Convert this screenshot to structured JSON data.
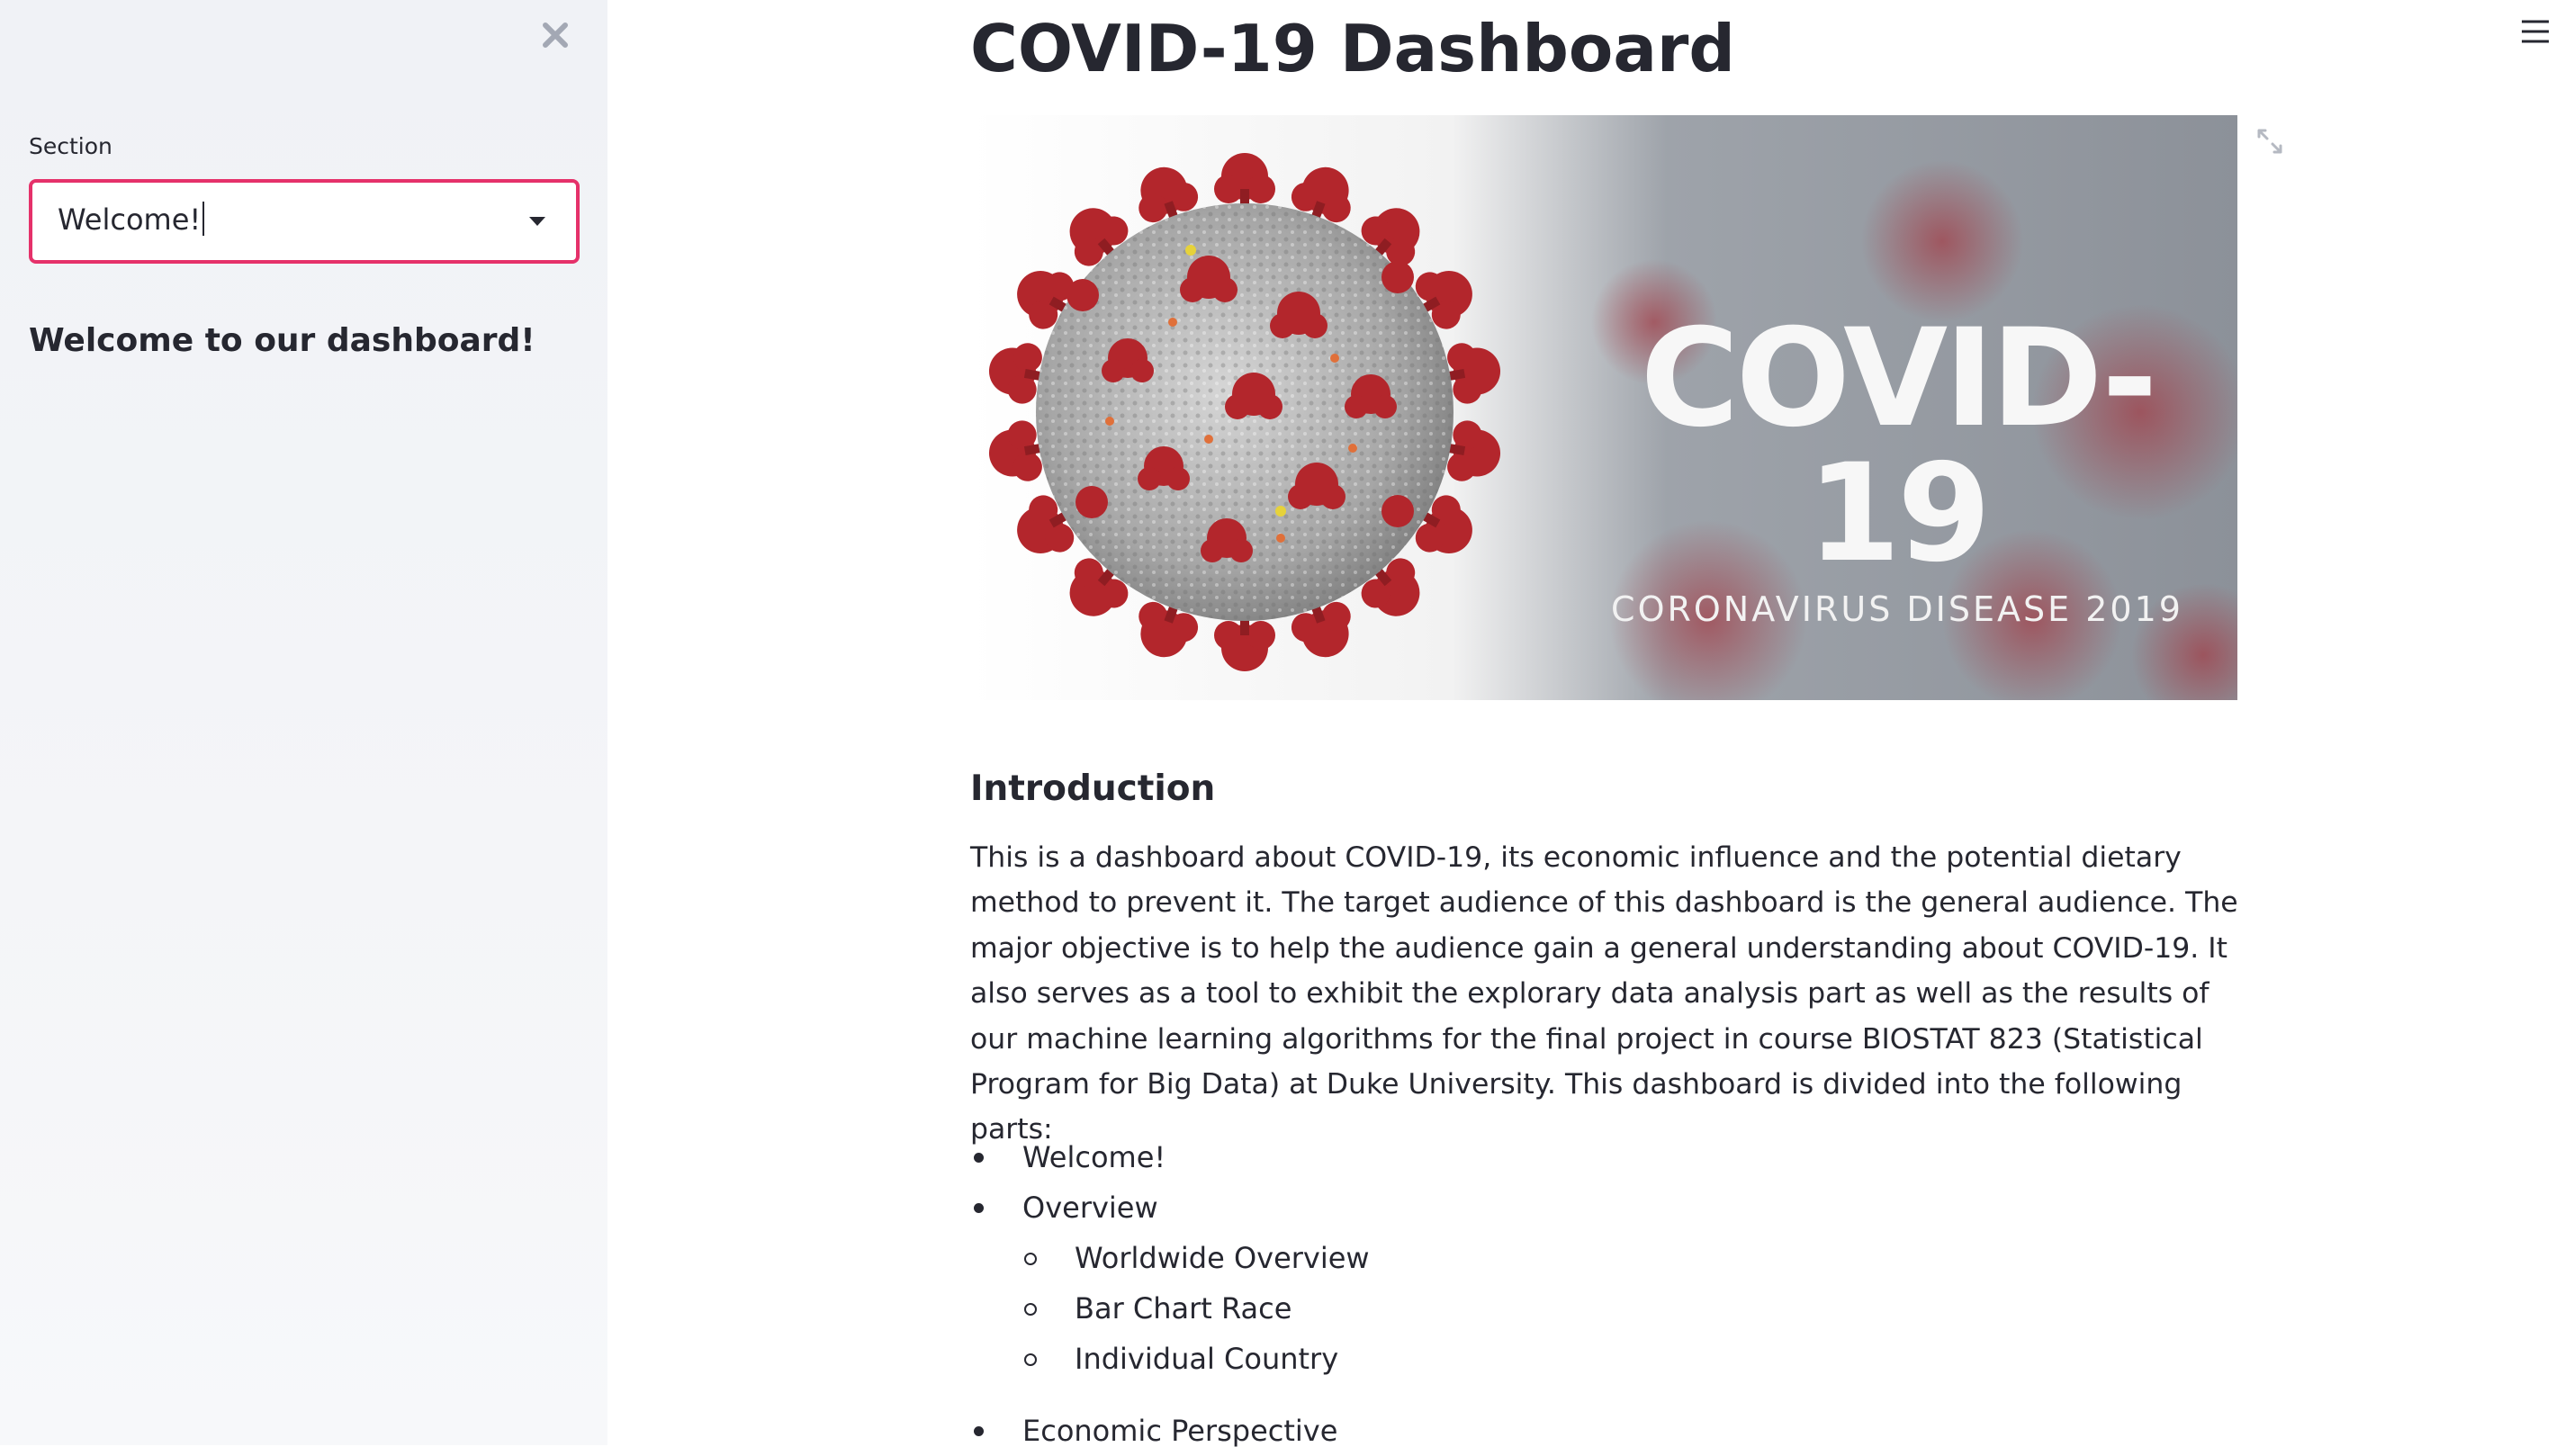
{
  "sidebar": {
    "section_label": "Section",
    "select_value": "Welcome!",
    "welcome_text": "Welcome to our dashboard!"
  },
  "main": {
    "title": "COVID-19 Dashboard",
    "hero": {
      "headline": "COVID-19",
      "subheadline": "CORONAVIRUS DISEASE 2019"
    },
    "intro_heading": "Introduction",
    "intro_paragraph": "This is a dashboard about COVID-19, its economic influence and the potential dietary method to prevent it. The target audience of this dashboard is the general audience. The major objective is to help the audience gain a general understanding about COVID-19. It also serves as a tool to exhibit the explorary data analysis part as well as the results of our machine learning algorithms for the final project in course BIOSTAT 823 (Statistical Program for Big Data) at Duke University. This dashboard is divided into the following parts:",
    "parts": [
      {
        "label": "Welcome!"
      },
      {
        "label": "Overview",
        "children": [
          "Worldwide Overview",
          "Bar Chart Race",
          "Individual Country"
        ]
      },
      {
        "label": "Economic Perspective"
      }
    ]
  },
  "colors": {
    "accent": "#e5316a",
    "sidebar_bg": "#f0f2f6",
    "text": "#262730",
    "virus_red": "#b3262c",
    "virus_grey": "#9a9a9a"
  },
  "icons": {
    "close": "close-icon",
    "dropdown": "chevron-down-icon",
    "menu": "hamburger-menu-icon",
    "fullscreen": "expand-icon"
  }
}
